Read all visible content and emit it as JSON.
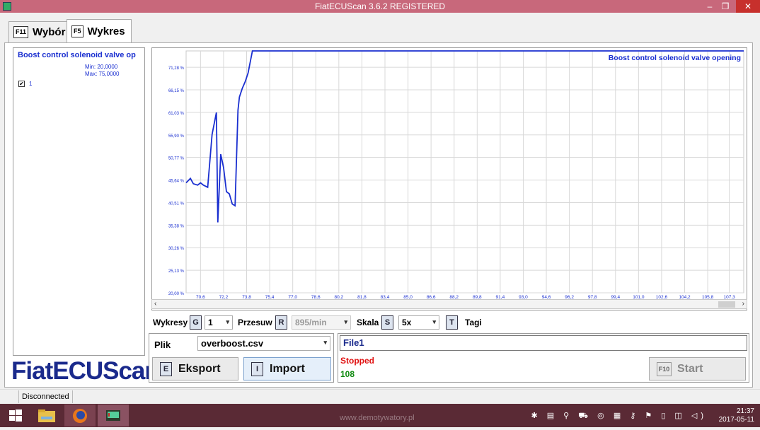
{
  "window": {
    "title": "FiatECUScan 3.6.2 REGISTERED",
    "minimize": "–",
    "restore": "❐",
    "close": "✕"
  },
  "tabs": [
    {
      "key": "F11",
      "label": "Wybór"
    },
    {
      "key": "F5",
      "label": "Wykres"
    }
  ],
  "left_panel": {
    "series_title": "Boost control solenoid valve op",
    "min": "Min: 20,0000",
    "max": "Max: 75,0000",
    "checkbox_label": "1",
    "checkbox_checked": true
  },
  "logo": "FiatECUScan",
  "chart_data": {
    "type": "line",
    "legend": "Boost control solenoid valve opening",
    "color": "#1a2fd0",
    "ylim": [
      20.0,
      75.0
    ],
    "xlim": [
      69.6,
      108.3
    ],
    "y_ticks": [
      "20,00 %",
      "25,13 %",
      "30,26 %",
      "35,38 %",
      "40,51 %",
      "45,64 %",
      "50,77 %",
      "55,90 %",
      "61,03 %",
      "66,15 %",
      "71,28 %"
    ],
    "x_ticks": [
      "70,6",
      "72,2",
      "73,8",
      "75,4",
      "77,0",
      "78,6",
      "80,2",
      "81,8",
      "83,4",
      "85,0",
      "86,6",
      "88,2",
      "89,8",
      "91,4",
      "93,0",
      "94,6",
      "96,2",
      "97,8",
      "99,4",
      "101,0",
      "102,6",
      "104,2",
      "105,8",
      "107,3"
    ],
    "x": [
      69.6,
      69.9,
      70.1,
      70.4,
      70.6,
      70.8,
      71.1,
      71.4,
      71.7,
      71.8,
      72.0,
      72.2,
      72.4,
      72.6,
      72.8,
      73.0,
      73.2,
      73.3,
      73.5,
      73.7,
      73.9,
      74.2,
      74.5,
      76.0,
      80.0,
      90.0,
      100.0,
      108.3
    ],
    "y": [
      45.0,
      46.0,
      44.8,
      44.5,
      45.0,
      44.5,
      44.0,
      56.0,
      61.0,
      36.0,
      51.5,
      48.5,
      43.0,
      42.5,
      40.2,
      39.8,
      61.5,
      64.5,
      66.5,
      68.0,
      70.0,
      75.0,
      75.0,
      75.0,
      75.0,
      75.0,
      75.0,
      75.0
    ],
    "grid": true
  },
  "controls": {
    "wykresy_label": "Wykresy",
    "wykresy_key": "G",
    "wykresy_value": "1",
    "przesuw_label": "Przesuw",
    "przesuw_key": "R",
    "przesuw_value": "895/min",
    "skala_label": "Skala",
    "skala_key": "S",
    "skala_value": "5x",
    "tagi_key": "T",
    "tagi_label": "Tagi"
  },
  "file": {
    "plik_label": "Plik",
    "plik_value": "overboost.csv",
    "eksport_key": "E",
    "eksport_label": "Eksport",
    "import_key": "I",
    "import_label": "Import"
  },
  "status": {
    "file_name": "File1",
    "state": "Stopped",
    "state_color": "#e01010",
    "count": "108",
    "count_color": "#108a10",
    "start_key": "F10",
    "start_label": "Start"
  },
  "statusbar": {
    "connection": "Disconnected"
  },
  "taskbar": {
    "watermark": "www.demotywatory.pl",
    "tray_icons": "✱ ▤ ⚲ ⛟ ◎ ▦ ⚷ ⚑ ▯ ◫ ◁)",
    "time": "21:37",
    "date": "2017-05-11"
  }
}
